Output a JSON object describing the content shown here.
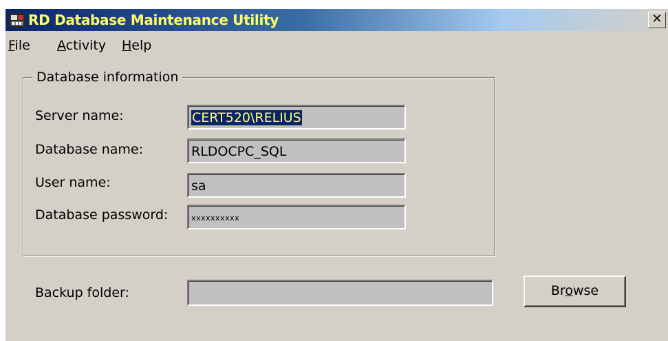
{
  "window": {
    "title": "RD Database Maintenance Utility",
    "close_glyph": "✕"
  },
  "menu": {
    "file": {
      "first": "F",
      "rest": "ile"
    },
    "activity": {
      "first": "A",
      "rest": "ctivity"
    },
    "help": {
      "first": "H",
      "rest": "elp"
    }
  },
  "database_info": {
    "legend": "Database information",
    "server_label": "Server name:",
    "server_value": "CERT520\\RELIUS",
    "database_label": "Database name:",
    "database_value": "RLDOCPC_SQL",
    "user_label": "User name:",
    "user_value": "sa",
    "password_label": "Database password:",
    "password_value": "xxxxxxxxxx"
  },
  "backup": {
    "label": "Backup folder:",
    "value": ""
  },
  "browse_button": {
    "pre": "Br",
    "underlined": "o",
    "post": "wse"
  },
  "icons": {
    "app": "database-utility-icon",
    "close": "close-icon"
  }
}
